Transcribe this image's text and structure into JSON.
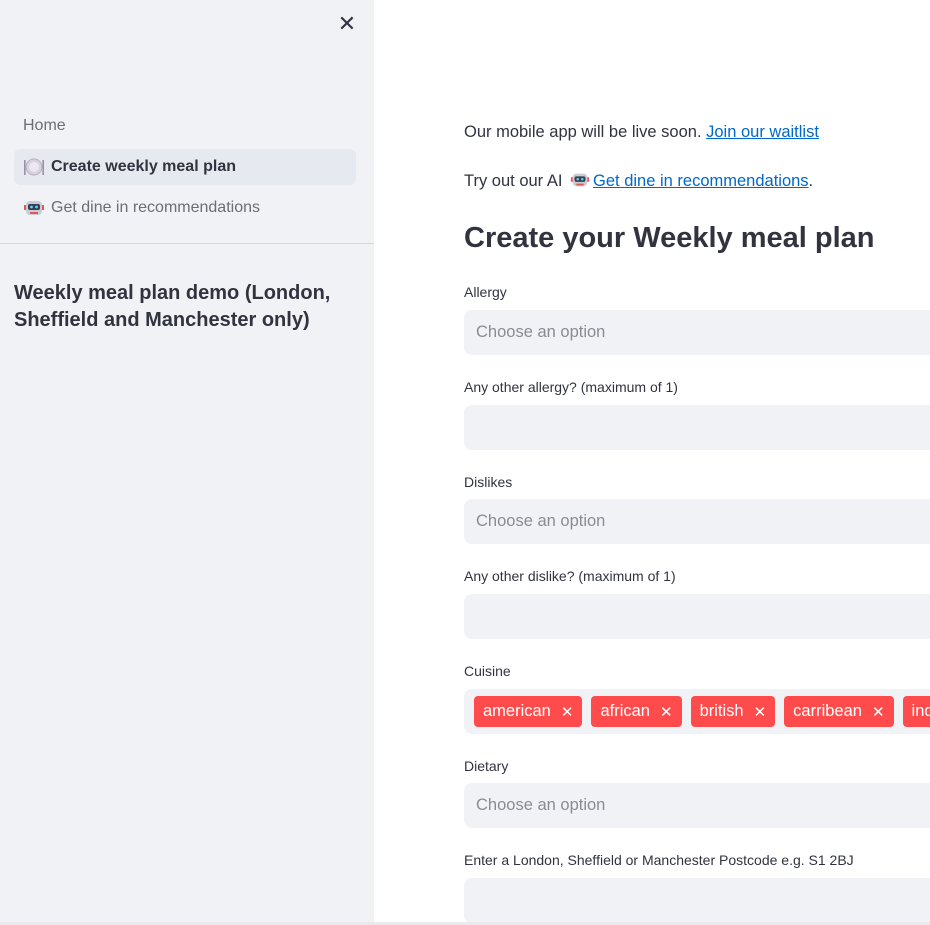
{
  "sidebar": {
    "close_icon": "close-icon",
    "nav": [
      {
        "label": "Home",
        "active": false
      },
      {
        "label": "Create weekly meal plan",
        "active": true,
        "icon": "plate-icon"
      },
      {
        "label": "Get dine in recommendations",
        "active": false,
        "icon": "robot-icon"
      }
    ],
    "heading": "Weekly meal plan demo (London, Sheffield and Manchester only)"
  },
  "main": {
    "announcement": {
      "text": "Our mobile app will be live soon. ",
      "link": "Join our waitlist"
    },
    "ai_line": {
      "text": "Try out our AI ",
      "link": "Get dine in recommendations",
      "suffix": "."
    },
    "title": "Create your Weekly meal plan",
    "form": {
      "allergy": {
        "label": "Allergy",
        "placeholder": "Choose an option"
      },
      "other_allergy": {
        "label": "Any other allergy? (maximum of 1)",
        "value": ""
      },
      "dislikes": {
        "label": "Dislikes",
        "placeholder": "Choose an option"
      },
      "other_dislike": {
        "label": "Any other dislike? (maximum of 1)",
        "value": ""
      },
      "cuisine": {
        "label": "Cuisine",
        "selected": [
          "american",
          "african",
          "british",
          "carribean",
          "ind"
        ]
      },
      "dietary": {
        "label": "Dietary",
        "placeholder": "Choose an option"
      },
      "postcode": {
        "label": "Enter a London, Sheffield or Manchester Postcode e.g. S1 2BJ",
        "value": ""
      }
    }
  },
  "colors": {
    "accent": "#ff4b4b",
    "link": "#0068c9",
    "sidebar_bg": "#f0f2f6",
    "text": "#31333f"
  }
}
